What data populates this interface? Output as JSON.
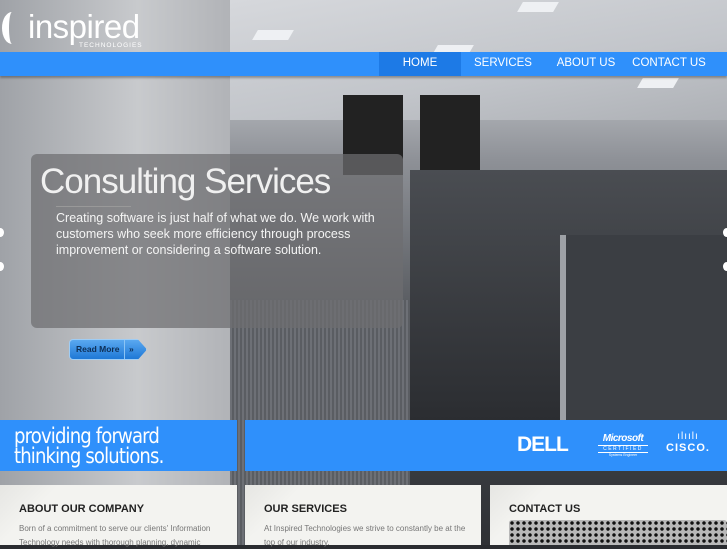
{
  "logo": {
    "name": "inspired",
    "sub": "TECHNOLOGIES"
  },
  "nav": {
    "items": [
      {
        "label": "HOME",
        "active": true
      },
      {
        "label": "SERVICES"
      },
      {
        "label": "ABOUT US"
      },
      {
        "label": "CONTACT US"
      }
    ]
  },
  "hero": {
    "title": "Consulting Services",
    "text": "Creating software is just half of what we do. We work with customers who seek more efficiency through process improvement or considering a software solution.",
    "button": "Read More",
    "button_arrow": "»"
  },
  "tagline": {
    "line1": "providing forward",
    "line2": "thinking solutions."
  },
  "partners": {
    "dell": "DELL",
    "ms": "Microsoft",
    "ms_cert": "CERTIFIED",
    "ms_sub": "Systems Engineer",
    "cisco_bars": "ılıılı",
    "cisco": "CISCO."
  },
  "cards": [
    {
      "title": "ABOUT OUR COMPANY",
      "text": "Born of a commitment to serve our clients' Information Technology needs with thorough planning, dynamic"
    },
    {
      "title": "OUR SERVICES",
      "text": "At Inspired Technologies we strive to constantly be at the top of our industry."
    },
    {
      "title": "CONTACT US"
    }
  ],
  "colors": {
    "accent": "#2f90fb",
    "accent_active": "#1d7ae6"
  }
}
